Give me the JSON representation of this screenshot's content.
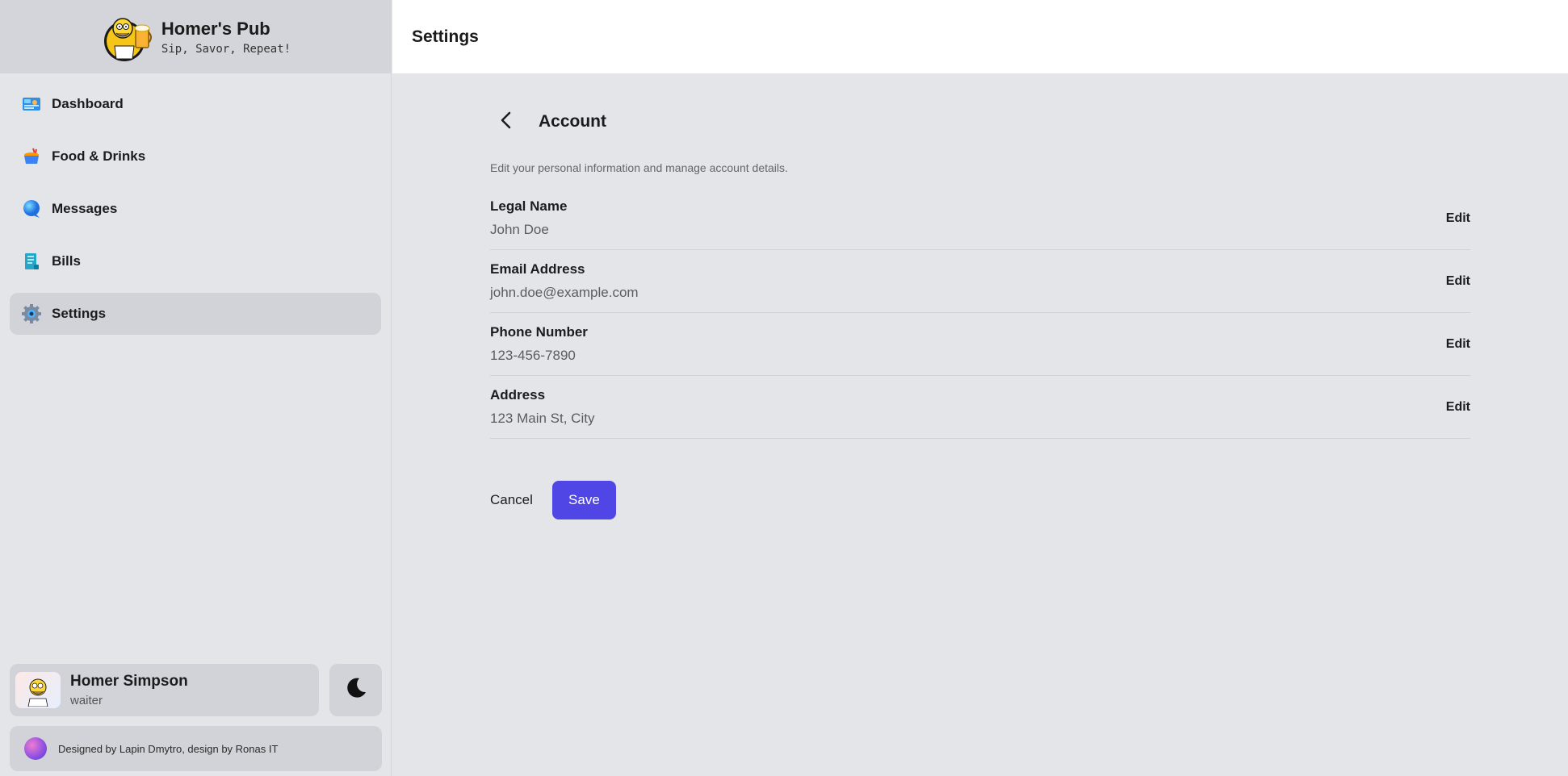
{
  "brand": {
    "title": "Homer's Pub",
    "subtitle": "Sip, Savor, Repeat!"
  },
  "sidebar": {
    "items": [
      {
        "label": "Dashboard",
        "icon": "dashboard-icon"
      },
      {
        "label": "Food & Drinks",
        "icon": "food-icon"
      },
      {
        "label": "Messages",
        "icon": "chat-bubble-icon"
      },
      {
        "label": "Bills",
        "icon": "receipt-icon"
      },
      {
        "label": "Settings",
        "icon": "gear-icon",
        "active": true
      }
    ]
  },
  "user": {
    "name": "Homer Simpson",
    "role": "waiter"
  },
  "credits": "Designed by Lapin Dmytro, design by Ronas IT",
  "header": {
    "title": "Settings"
  },
  "account": {
    "title": "Account",
    "description": "Edit your personal information and manage account details.",
    "fields": [
      {
        "label": "Legal Name",
        "value": "John Doe",
        "action": "Edit"
      },
      {
        "label": "Email Address",
        "value": "john.doe@example.com",
        "action": "Edit"
      },
      {
        "label": "Phone Number",
        "value": "123-456-7890",
        "action": "Edit"
      },
      {
        "label": "Address",
        "value": "123 Main St, City",
        "action": "Edit"
      }
    ],
    "cancel_label": "Cancel",
    "save_label": "Save"
  },
  "colors": {
    "accent": "#4f46e5",
    "sidebar_bg": "#e4e5e9",
    "active_item_bg": "#d2d3d8"
  }
}
